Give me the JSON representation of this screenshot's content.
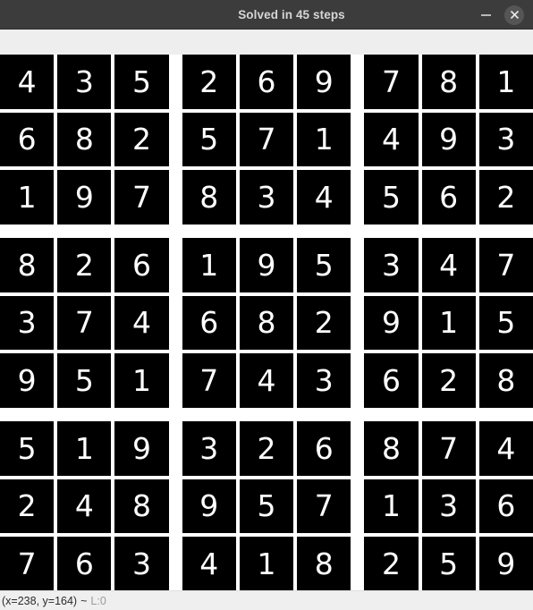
{
  "window": {
    "title": "Solved in 45 steps",
    "titlebar_bg": "#3c3c3c",
    "title_color": "#d6d6d6",
    "controls": {
      "minimize_label": "–",
      "minimize_icon": "minimize-icon",
      "close_label": "×",
      "close_icon": "close-icon"
    }
  },
  "board": {
    "background": "#ffffff",
    "cell_bg": "#000000",
    "digit_color": "#ffffff",
    "rows": 9,
    "cols": 9,
    "grid": [
      [
        4,
        3,
        5,
        2,
        6,
        9,
        7,
        8,
        1
      ],
      [
        6,
        8,
        2,
        5,
        7,
        1,
        4,
        9,
        3
      ],
      [
        1,
        9,
        7,
        8,
        3,
        4,
        5,
        6,
        2
      ],
      [
        8,
        2,
        6,
        1,
        9,
        5,
        3,
        4,
        7
      ],
      [
        3,
        7,
        4,
        6,
        8,
        2,
        9,
        1,
        5
      ],
      [
        9,
        5,
        1,
        7,
        4,
        3,
        6,
        2,
        8
      ],
      [
        5,
        1,
        9,
        3,
        2,
        6,
        8,
        7,
        4
      ],
      [
        2,
        4,
        8,
        9,
        5,
        7,
        1,
        3,
        6
      ],
      [
        7,
        6,
        3,
        4,
        1,
        8,
        2,
        5,
        9
      ]
    ]
  },
  "status": {
    "coords": "(x=238, y=164)",
    "separator": "~",
    "level": "L:0",
    "level_color": "#9a9a9a"
  }
}
